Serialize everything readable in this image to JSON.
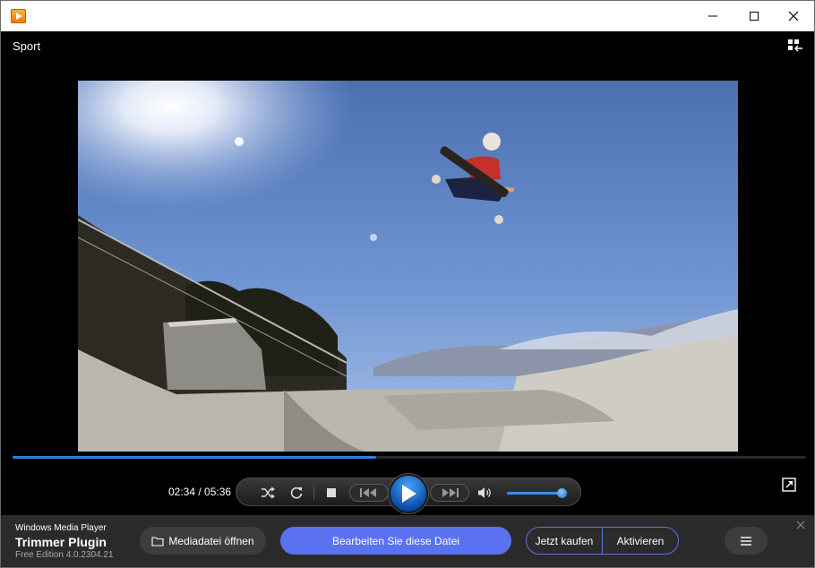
{
  "window": {
    "app_icon": "media-player-app-icon",
    "controls": [
      "minimize-icon",
      "maximize-icon",
      "close-icon"
    ]
  },
  "player": {
    "media_title": "Sport",
    "time": "02:34 / 05:36",
    "progress": 0.4583,
    "volume": 0.95
  },
  "bottom_bar": {
    "brand_sub": "Windows Media Player",
    "brand_title": "Trimmer Plugin",
    "brand_edition": "Free Edition 4.0.2304.21",
    "open_label": "Mediadatei öffnen",
    "edit_label": "Bearbeiten Sie diese Datei",
    "buy_label": "Jetzt kaufen",
    "activate_label": "Aktivieren"
  },
  "colors": {
    "accent": "#5b72f0",
    "seek_fill": "#2f7fd8",
    "bar_bg": "#2b2b2b"
  }
}
